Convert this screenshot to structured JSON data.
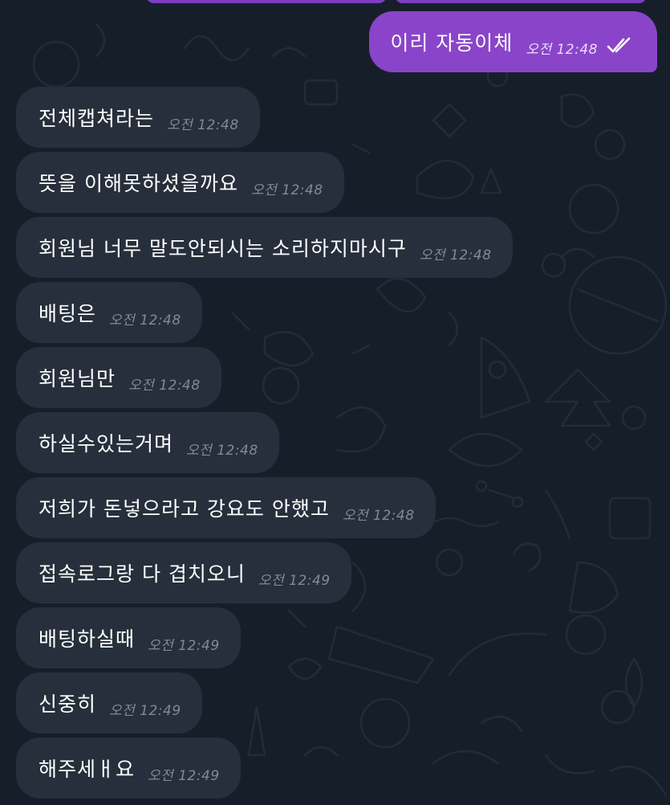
{
  "chat": {
    "outgoing": [
      {
        "text": "이리 자동이체",
        "time": "오전 12:48",
        "status_icon": "double-check-icon"
      }
    ],
    "incoming": [
      {
        "text": "전체캡쳐라는",
        "time": "오전 12:48"
      },
      {
        "text": "뜻을 이해못하셨을까요",
        "time": "오전 12:48"
      },
      {
        "text": "회원님 너무 말도안되시는 소리하지마시구",
        "time": "오전 12:48"
      },
      {
        "text": "배팅은",
        "time": "오전 12:48"
      },
      {
        "text": "회원님만",
        "time": "오전 12:48"
      },
      {
        "text": "하실수있는거며",
        "time": "오전 12:48"
      },
      {
        "text": "저희가 돈넣으라고 강요도 안했고",
        "time": "오전 12:48"
      },
      {
        "text": "접속로그랑 다 겹치오니",
        "time": "오전 12:49"
      },
      {
        "text": "배팅하실때",
        "time": "오전 12:49"
      },
      {
        "text": "신중히",
        "time": "오전 12:49"
      },
      {
        "text": "해주세ㅐ요",
        "time": "오전 12:49"
      }
    ]
  },
  "colors": {
    "background": "#161f29",
    "incoming_bubble": "#262f3b",
    "outgoing_bubble": "#8a44c9",
    "incoming_time": "#7e8a99",
    "outgoing_time": "#ecdbfb"
  }
}
